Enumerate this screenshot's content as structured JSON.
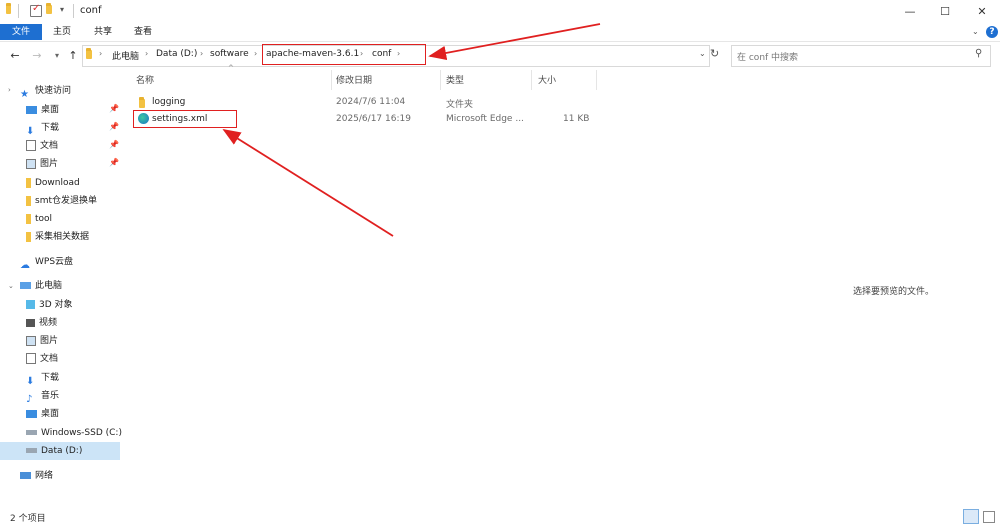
{
  "window": {
    "title": "conf",
    "controls": {
      "minimize": "—",
      "maximize": "☐",
      "close": "✕"
    }
  },
  "ribbon": {
    "tabs": [
      {
        "label": "文件"
      },
      {
        "label": "主页"
      },
      {
        "label": "共享"
      },
      {
        "label": "查看"
      }
    ],
    "help": "?"
  },
  "address_bar": {
    "crumbs": [
      "此电脑",
      "Data (D:)",
      "software",
      "apache-maven-3.6.1",
      "conf"
    ]
  },
  "search": {
    "placeholder": "在 conf 中搜索"
  },
  "nav_pane": {
    "quick_access": "快速访问",
    "quick_items": [
      "桌面",
      "下载",
      "文档",
      "图片",
      "Download",
      "smt仓发退换单",
      "tool",
      "采集相关数据"
    ],
    "wps": "WPS云盘",
    "this_pc": "此电脑",
    "pc_items": [
      "3D 对象",
      "视频",
      "图片",
      "文档",
      "下载",
      "音乐",
      "桌面",
      "Windows-SSD (C:)",
      "Data (D:)"
    ],
    "network": "网络"
  },
  "columns": {
    "name": "名称",
    "modified": "修改日期",
    "type": "类型",
    "size": "大小"
  },
  "files": [
    {
      "name": "logging",
      "modified": "2024/7/6 11:04",
      "type": "文件夹",
      "size": ""
    },
    {
      "name": "settings.xml",
      "modified": "2025/6/17 16:19",
      "type": "Microsoft Edge ...",
      "size": "11 KB"
    }
  ],
  "preview_message": "选择要预览的文件。",
  "status": {
    "count": "2 个项目"
  },
  "colors": {
    "accent": "#1e6fd1",
    "selection": "#cce4f7",
    "annotation": "#e02020"
  }
}
